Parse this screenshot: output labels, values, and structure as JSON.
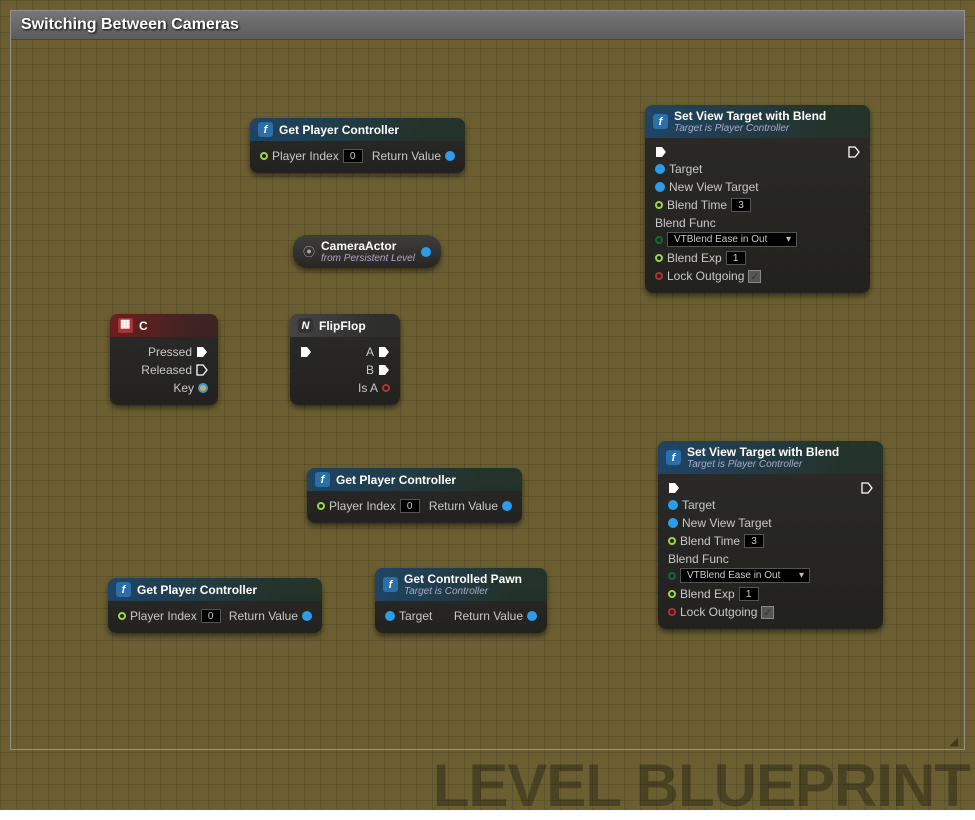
{
  "frame": {
    "title": "Switching Between Cameras"
  },
  "watermark": "LEVEL BLUEPRINT",
  "icons": {
    "f_label": "f",
    "macro_label": "N"
  },
  "nodes": {
    "getpc1": {
      "title": "Get Player Controller",
      "player_index_label": "Player Index",
      "player_index_value": "0",
      "return_label": "Return Value"
    },
    "camera": {
      "title": "CameraActor",
      "subtitle": "from Persistent Level"
    },
    "keyC": {
      "title": "C",
      "pressed": "Pressed",
      "released": "Released",
      "key": "Key"
    },
    "flipflop": {
      "title": "FlipFlop",
      "A": "A",
      "B": "B",
      "isA": "Is A"
    },
    "svt1": {
      "title": "Set View Target with Blend",
      "subtitle": "Target is Player Controller",
      "target": "Target",
      "new_view_target": "New View Target",
      "blend_time_label": "Blend Time",
      "blend_time_value": "3",
      "blend_func_label": "Blend Func",
      "blend_func_value": "VTBlend Ease in Out",
      "blend_exp_label": "Blend Exp",
      "blend_exp_value": "1",
      "lock_outgoing": "Lock Outgoing",
      "lock_outgoing_checked": "✓"
    },
    "getpc2": {
      "title": "Get Player Controller",
      "player_index_label": "Player Index",
      "player_index_value": "0",
      "return_label": "Return Value"
    },
    "getpc3": {
      "title": "Get Player Controller",
      "player_index_label": "Player Index",
      "player_index_value": "0",
      "return_label": "Return Value"
    },
    "pawn": {
      "title": "Get Controlled Pawn",
      "subtitle": "Target is Controller",
      "target": "Target",
      "return_label": "Return Value"
    },
    "svt2": {
      "title": "Set View Target with Blend",
      "subtitle": "Target is Player Controller",
      "target": "Target",
      "new_view_target": "New View Target",
      "blend_time_label": "Blend Time",
      "blend_time_value": "3",
      "blend_func_label": "Blend Func",
      "blend_func_value": "VTBlend Ease in Out",
      "blend_exp_label": "Blend Exp",
      "blend_exp_value": "1",
      "lock_outgoing": "Lock Outgoing",
      "lock_outgoing_checked": "✓"
    }
  }
}
